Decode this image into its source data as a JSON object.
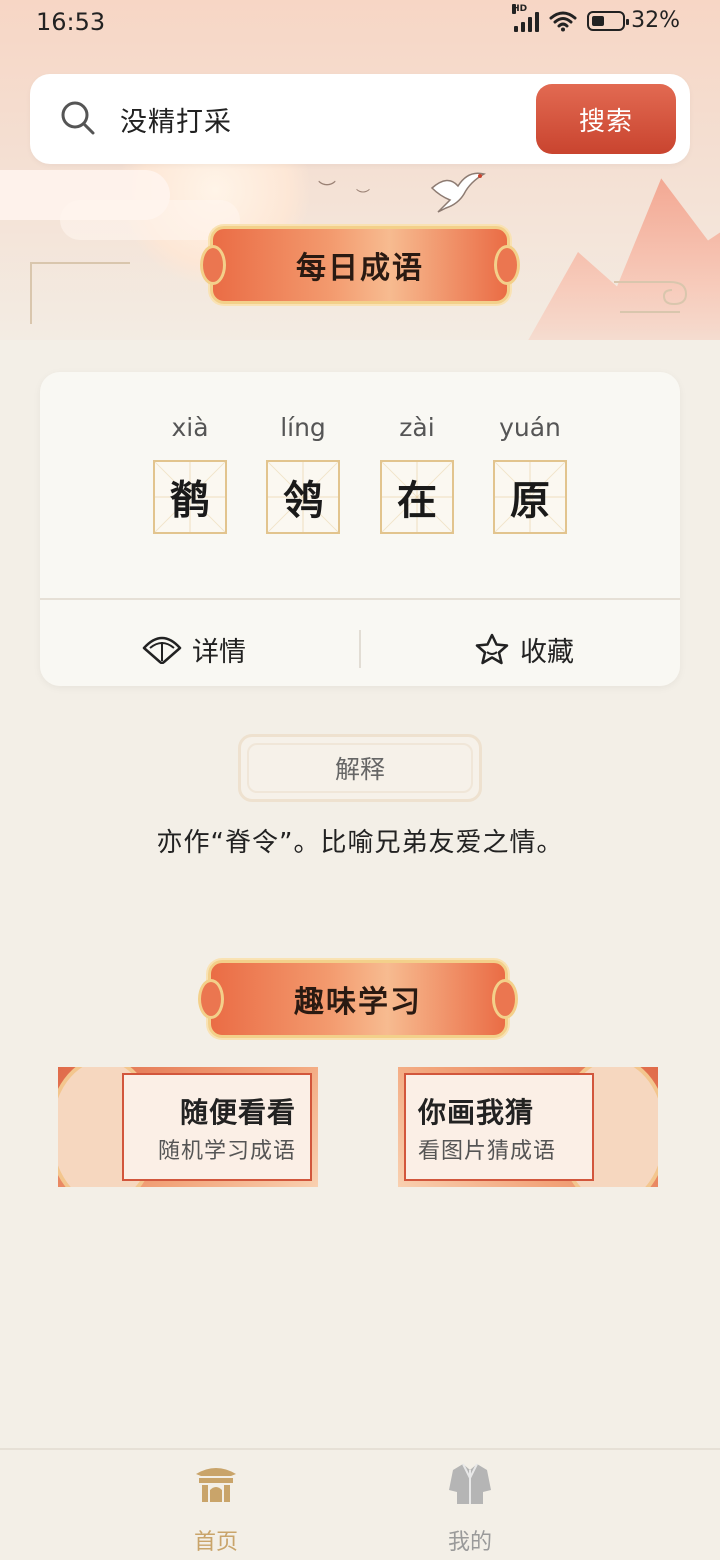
{
  "status_bar": {
    "time": "16:53",
    "signal_label": "HD",
    "battery": "32%"
  },
  "search": {
    "value": "没精打采",
    "button_label": "搜索"
  },
  "daily_section": {
    "title": "每日成语",
    "characters": [
      {
        "pinyin": "xià",
        "char": "鹡"
      },
      {
        "pinyin": "líng",
        "char": "鸰"
      },
      {
        "pinyin": "zài",
        "char": "在"
      },
      {
        "pinyin": "yuán",
        "char": "原"
      }
    ],
    "details_label": "详情",
    "favorite_label": "收藏"
  },
  "explanation": {
    "label": "解释",
    "text": "亦作“脊令”。比喻兄弟友爱之情。"
  },
  "fun_section": {
    "title": "趣味学习",
    "cards": [
      {
        "title": "随便看看",
        "subtitle": "随机学习成语"
      },
      {
        "title": "你画我猜",
        "subtitle": "看图片猜成语"
      }
    ]
  },
  "bottom_nav": {
    "items": [
      {
        "label": "首页",
        "icon": "home-pavilion-icon",
        "active": true
      },
      {
        "label": "我的",
        "icon": "profile-robe-icon",
        "active": false
      }
    ]
  },
  "colors": {
    "accent": "#c9442f",
    "banner": "#ea6c45",
    "gold": "#e2c48e",
    "nav_active": "#c9a46a",
    "nav_inactive": "#9a9a9a"
  }
}
